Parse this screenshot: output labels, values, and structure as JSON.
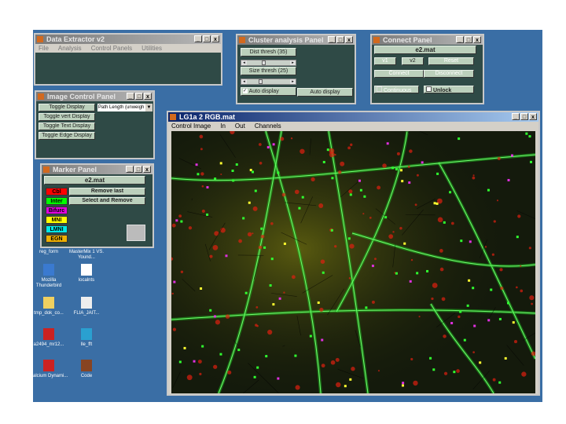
{
  "data_extractor": {
    "title": "Data Extractor v2",
    "menu": [
      "File",
      "Analysis",
      "Control Panels",
      "Utilities"
    ]
  },
  "cluster": {
    "title": "Cluster analysis Panel",
    "dist_thresh": "Dist thresh (35)",
    "dist_value_fraction": 0.3,
    "size_thresh": "Size thresh (25)",
    "size_value_fraction": 0.2,
    "auto_display_checkbox": "Auto display",
    "auto_display_checked": true,
    "auto_display_button": "Auto display"
  },
  "connect": {
    "title": "Connect Panel",
    "file": "e2.mat",
    "v1": "v1",
    "v2": "v2",
    "reset": "Reset",
    "connect": "Connect",
    "disconnect": "Disconnect",
    "continuous": "Continuous",
    "unlock": "Unlock"
  },
  "image_control": {
    "title": "Image Control Panel",
    "buttons": [
      "Toggle Display",
      "Toggle vert Display",
      "Toggle Text Display",
      "Toggle Edge Display"
    ],
    "dropdown_value": "Path Length (unweigh"
  },
  "marker": {
    "title": "Marker Panel",
    "file": "e2.mat",
    "markers": [
      {
        "label": "Cbl",
        "color": "#ff0000"
      },
      {
        "label": "Inter",
        "color": "#00ff00"
      },
      {
        "label": "Bifurc",
        "color": "#e000e0"
      },
      {
        "label": "MNI",
        "color": "#ffff00"
      },
      {
        "label": "LMNI",
        "color": "#00e8e8"
      },
      {
        "label": "EGN",
        "color": "#f0b000"
      }
    ],
    "remove_last": "Remove last",
    "select_remove": "Select and Remove"
  },
  "image_window": {
    "title": "LG1a 2 RGB.mat",
    "menu": [
      "Control Image",
      "In",
      "Out",
      "Channels"
    ]
  },
  "desktop_icons": [
    {
      "label": "reg_form"
    },
    {
      "label": "MasterMix 1 VS. Yound..."
    },
    {
      "label": "Mozilla Thunderbird"
    },
    {
      "label": "localnts"
    },
    {
      "label": "tmp_dok_co..."
    },
    {
      "label": "FLIA_JAIT..."
    },
    {
      "label": "a2494_mr12..."
    },
    {
      "label": "lle_fft"
    },
    {
      "label": "Calcium Dynami..."
    },
    {
      "label": "Code"
    }
  ],
  "window_controls": {
    "minimize": "_",
    "maximize": "□",
    "close": "x"
  }
}
